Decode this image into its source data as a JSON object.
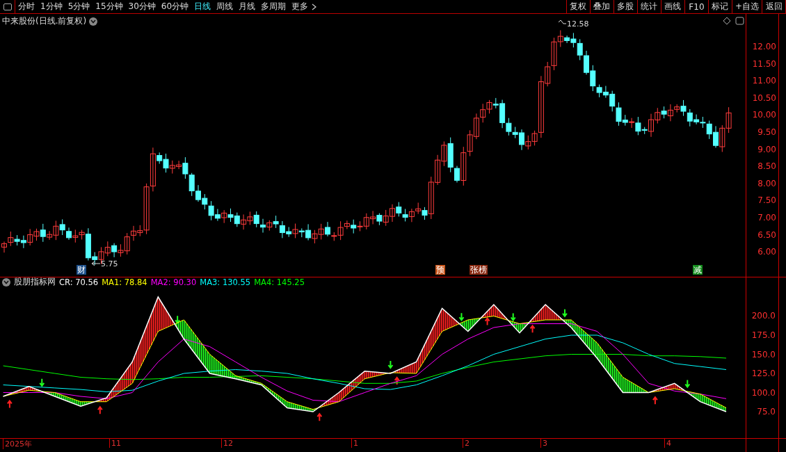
{
  "toolbar": {
    "periods": [
      {
        "label": "分时",
        "selected": false
      },
      {
        "label": "1分钟",
        "selected": false
      },
      {
        "label": "5分钟",
        "selected": false
      },
      {
        "label": "15分钟",
        "selected": false
      },
      {
        "label": "30分钟",
        "selected": false
      },
      {
        "label": "60分钟",
        "selected": false
      },
      {
        "label": "日线",
        "selected": true
      },
      {
        "label": "周线",
        "selected": false
      },
      {
        "label": "月线",
        "selected": false
      },
      {
        "label": "多周期",
        "selected": false
      },
      {
        "label": "更多",
        "selected": false
      }
    ],
    "actions": [
      "复权",
      "叠加",
      "多股",
      "统计",
      "画线",
      "F10",
      "标记",
      "+自选",
      "返回"
    ]
  },
  "price_chart": {
    "title": "中来股份(日线.前复权)",
    "high_label": "12.58",
    "low_label": "5.75",
    "y_ticks": [
      "12.00",
      "11.50",
      "11.00",
      "10.50",
      "10.00",
      "9.50",
      "9.00",
      "8.50",
      "8.00",
      "7.50",
      "7.00",
      "6.50",
      "6.00"
    ],
    "event_tags": [
      {
        "label": "财",
        "color": "#1c4f8a"
      },
      {
        "label": "预",
        "color": "#c8561c"
      },
      {
        "label": "张榜",
        "color": "#8a2a12"
      },
      {
        "label": "减",
        "color": "#138c1c"
      }
    ]
  },
  "indicator": {
    "name": "股朋指标网",
    "readings": [
      {
        "label": "CR: 70.56",
        "color": "#ffffff"
      },
      {
        "label": "MA1: 78.84",
        "color": "#ffff00"
      },
      {
        "label": "MA2: 90.30",
        "color": "#ff00ff"
      },
      {
        "label": "MA3: 130.55",
        "color": "#00ffff"
      },
      {
        "label": "MA4: 145.25",
        "color": "#00ff00"
      }
    ],
    "chart_data": {
      "type": "line",
      "categories": [
        null,
        null,
        null,
        null,
        null,
        null,
        null,
        null,
        null,
        null,
        null,
        null,
        null,
        null,
        null,
        null,
        null,
        null,
        null,
        null,
        null,
        null,
        null,
        null,
        null,
        null,
        null,
        null,
        null
      ],
      "ylim": [
        40.5,
        238.6
      ],
      "yticks": [
        {
          "value": 200,
          "label": "200.0"
        },
        {
          "value": 175,
          "label": "175.0"
        },
        {
          "value": 150,
          "label": "150.0"
        },
        {
          "value": 125,
          "label": "125.0"
        },
        {
          "value": 100,
          "label": "100.0"
        },
        {
          "value": 75,
          "label": "75.0"
        }
      ],
      "series": [
        {
          "color": "#ffffff",
          "values": [
            95,
            108,
            95,
            82,
            93,
            140,
            225,
            170,
            125,
            118,
            110,
            80,
            75,
            100,
            128,
            125,
            140,
            210,
            180,
            215,
            178,
            215,
            185,
            145,
            100,
            100,
            112,
            88,
            75
          ]
        },
        {
          "color": "#ffff00",
          "values": [
            95,
            103,
            100,
            88,
            88,
            112,
            180,
            195,
            150,
            122,
            112,
            88,
            78,
            88,
            118,
            126,
            125,
            180,
            195,
            200,
            190,
            195,
            195,
            165,
            120,
            100,
            105,
            98,
            80
          ]
        },
        {
          "color": "#ff00ff",
          "values": [
            100,
            100,
            100,
            95,
            92,
            100,
            140,
            170,
            160,
            140,
            120,
            102,
            90,
            88,
            100,
            112,
            122,
            150,
            170,
            185,
            190,
            190,
            190,
            180,
            150,
            112,
            102,
            98,
            92
          ]
        },
        {
          "color": "#00ffff",
          "values": [
            110,
            108,
            106,
            104,
            101,
            103,
            115,
            125,
            128,
            130,
            128,
            125,
            118,
            112,
            105,
            104,
            110,
            122,
            135,
            150,
            160,
            170,
            175,
            175,
            165,
            150,
            138,
            134,
            130
          ]
        },
        {
          "color": "#00ff00",
          "values": [
            135,
            130,
            125,
            120,
            118,
            117,
            118,
            120,
            120,
            121,
            122,
            120,
            118,
            115,
            112,
            112,
            115,
            125,
            133,
            140,
            144,
            148,
            150,
            150,
            150,
            148,
            148,
            147,
            145
          ]
        }
      ]
    }
  },
  "date_axis": [
    "2025年",
    "11",
    "12",
    "1",
    "2",
    "3",
    "4"
  ]
}
